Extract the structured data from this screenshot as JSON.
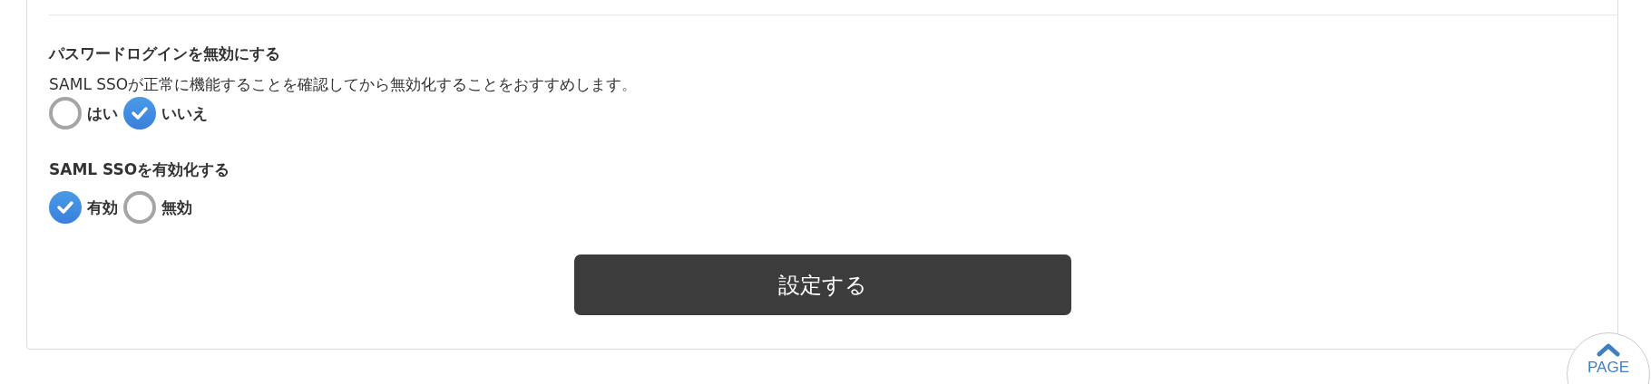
{
  "settings": [
    {
      "title": "パスワードログインを無効にする",
      "description": "SAML SSOが正常に機能することを確認してから無効化することをおすすめします。",
      "options": [
        {
          "label": "はい",
          "selected": false
        },
        {
          "label": "いいえ",
          "selected": true
        }
      ]
    },
    {
      "title": "SAML SSOを有効化する",
      "options": [
        {
          "label": "有効",
          "selected": true
        },
        {
          "label": "無効",
          "selected": false
        }
      ]
    }
  ],
  "submit": {
    "label": "設定する"
  },
  "page_top": {
    "label": "PAGE"
  }
}
